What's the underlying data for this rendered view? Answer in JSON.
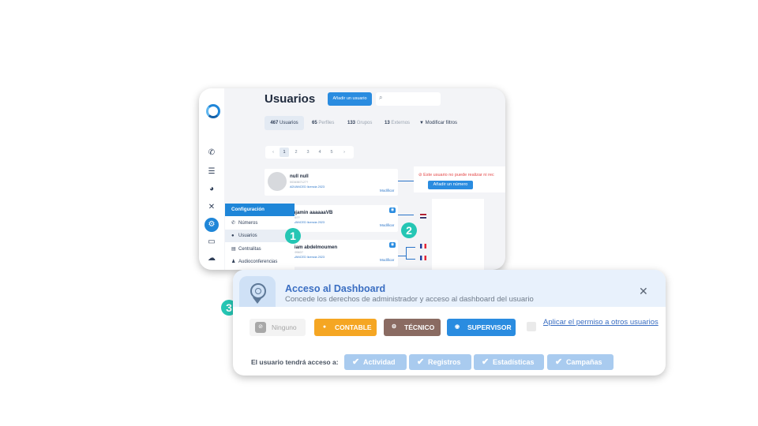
{
  "usuarios_panel": {
    "title": "Usuarios",
    "add_button": "Añadir un usuario",
    "tabs": [
      {
        "count": "467",
        "label": "Usuarios"
      },
      {
        "count": "65",
        "label": "Perfiles"
      },
      {
        "count": "133",
        "label": "Grupos"
      },
      {
        "count": "13",
        "label": "Externos"
      }
    ],
    "filter_label": "Modificar filtros",
    "pagination": [
      "‹",
      "1",
      "2",
      "3",
      "4",
      "5",
      "›"
    ],
    "users": [
      {
        "name": "null null",
        "sub": "0034567127?",
        "license": "ADVANCED licencia 2023",
        "action": "Modificar"
      },
      {
        "name": "enjamin aaaaaaVB",
        "sub": "0346??",
        "license": "ADVANCED licencia 2023",
        "action": "Modificar"
      },
      {
        "name": "yriam abdelmoumen",
        "sub": "0349940?",
        "license": "ADVANCED licencia 2023",
        "action": "Modificar"
      }
    ],
    "error_text": "Este usuario no puede realizar ni rec",
    "add_number_button": "Añadir un número",
    "config_menu": {
      "header": "Configuración",
      "items": [
        "Números",
        "Usuarios",
        "Centralitas",
        "Audioconferencias"
      ]
    }
  },
  "markers": [
    "1",
    "2",
    "3"
  ],
  "dashboard_access": {
    "title": "Acceso al Dashboard",
    "subtitle": "Concede los derechos de administrador y acceso al dashboard del usuario",
    "permissions": [
      "Ninguno",
      "CONTABLE",
      "TÉCNICO",
      "SUPERVISOR"
    ],
    "apply_link": "Aplicar el permiso a otros usuarios",
    "access_label": "El usuario tendrá acceso a:",
    "access_items": [
      "Actividad",
      "Registros",
      "Estadísticas",
      "Campañas"
    ]
  },
  "colors": {
    "primary": "#1f86d8",
    "marker": "#25c6b4",
    "contable": "#f5a623",
    "tecnico": "#8a6b62",
    "supervisor": "#2a8ce0",
    "access_chip": "#a9cbef",
    "error": "#e44848"
  }
}
